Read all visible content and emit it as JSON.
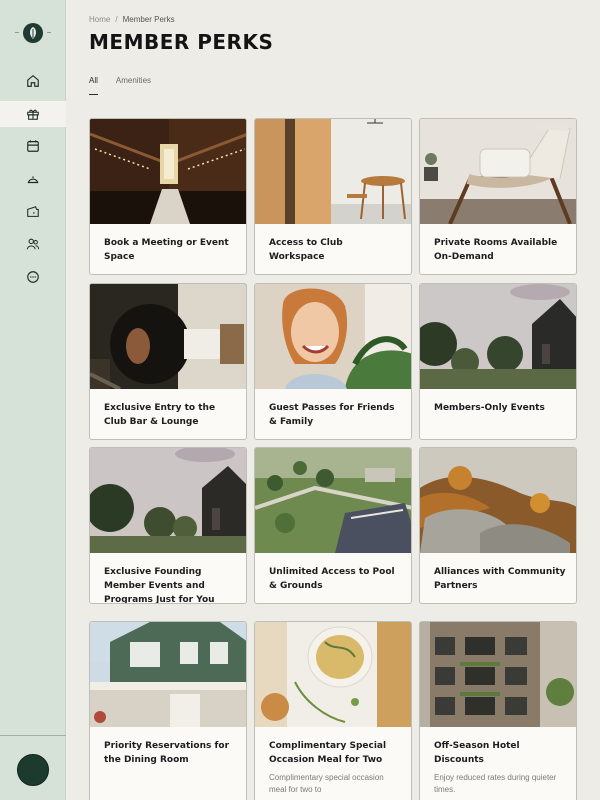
{
  "breadcrumb": {
    "home": "Home",
    "separator": "/",
    "current": "Member Perks"
  },
  "page_title": "MEMBER PERKS",
  "tabs": [
    {
      "label": "All",
      "active": true
    },
    {
      "label": "Amenities",
      "active": false
    }
  ],
  "sidebar": {
    "items": [
      {
        "icon": "home-icon"
      },
      {
        "icon": "gift-icon",
        "active": true
      },
      {
        "icon": "calendar-icon"
      },
      {
        "icon": "dining-cloche-icon"
      },
      {
        "icon": "ticket-icon"
      },
      {
        "icon": "people-icon"
      },
      {
        "icon": "chat-icon"
      }
    ]
  },
  "cards": [
    {
      "title": "Book a Meeting or Event Space"
    },
    {
      "title": "Access to Club Workspace"
    },
    {
      "title": "Private Rooms Available On-Demand"
    },
    {
      "title": "Exclusive Entry to the Club Bar & Lounge"
    },
    {
      "title": "Guest Passes for Friends & Family"
    },
    {
      "title": "Members-Only Events"
    },
    {
      "title": "Exclusive Founding Member Events and Programs Just for You"
    },
    {
      "title": "Unlimited Access to Pool & Grounds"
    },
    {
      "title": "Alliances with Community Partners"
    },
    {
      "title": "Priority Reservations for the Dining Room"
    },
    {
      "title": "Complimentary Special Occasion Meal for Two",
      "description": "Complimentary special occasion meal for two to"
    },
    {
      "title": "Off-Season Hotel Discounts",
      "description": "Enjoy reduced rates during quieter times."
    }
  ],
  "colors": {
    "sidebar": "#d6e2d8",
    "background": "#eeece7",
    "accent": "#1c3a2d"
  }
}
